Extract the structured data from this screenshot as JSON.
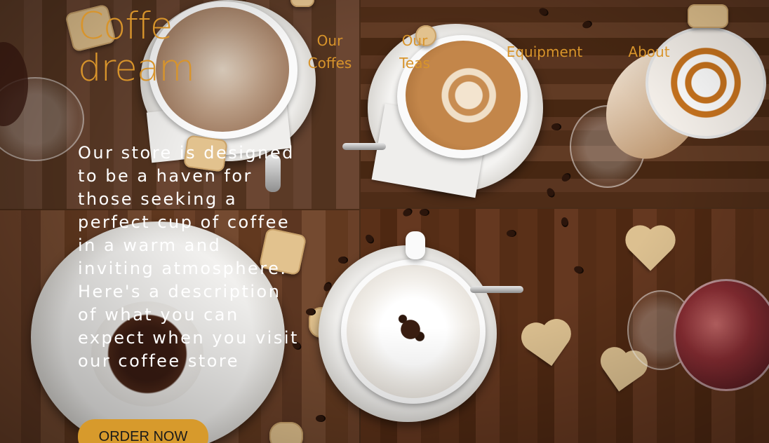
{
  "brand": {
    "logo_line1": "Coffe",
    "logo_line2": "dream",
    "accent_color": "#d8942b"
  },
  "nav": {
    "items": [
      {
        "label": "Our Coffes"
      },
      {
        "label": "Our Teas"
      },
      {
        "label": "Equipment"
      },
      {
        "label": "About"
      }
    ]
  },
  "hero": {
    "description": "Our store is designed to be a haven for those seeking a perfect cup of coffee in a warm and inviting atmosphere. Here's a description of what you can expect when you visit our coffee store",
    "cta_label": "ORDER NOW",
    "cta_color": "#d79a2c",
    "background": "coffee-table-photo"
  }
}
